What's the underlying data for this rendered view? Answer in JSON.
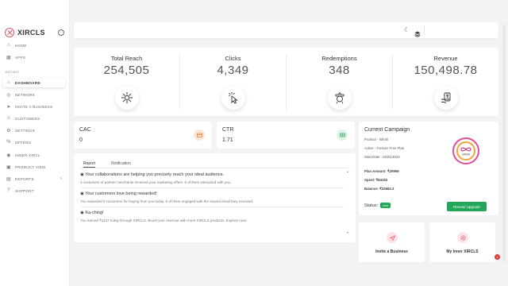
{
  "brand": {
    "name": "XIRCLS"
  },
  "sidebar": {
    "section_label": "INFINITI",
    "items": [
      {
        "label": "HOME"
      },
      {
        "label": "APPS"
      },
      {
        "label": "DASHBOARD"
      },
      {
        "label": "NETWORK"
      },
      {
        "label": "INVITE A BUSINESS"
      },
      {
        "label": "CUSTOMERS"
      },
      {
        "label": "SETTINGS"
      },
      {
        "label": "OFFERS"
      },
      {
        "label": "INNER XIRCL"
      },
      {
        "label": "PRODUCT VIEW"
      },
      {
        "label": "REPORTS"
      },
      {
        "label": "SUPPORT"
      }
    ]
  },
  "stats": [
    {
      "label": "Total Reach",
      "value": "254,505",
      "icon": "reach-icon"
    },
    {
      "label": "Clicks",
      "value": "4,349",
      "icon": "click-icon"
    },
    {
      "label": "Redemptions",
      "value": "348",
      "icon": "redemption-icon"
    },
    {
      "label": "Revenue",
      "value": "150,498.78",
      "icon": "revenue-icon"
    }
  ],
  "cac": {
    "label": "CAC",
    "value": "0"
  },
  "ctr": {
    "label": "CTR",
    "value": "1.71"
  },
  "report": {
    "tabs": [
      "Report",
      "Notification"
    ],
    "messages": [
      {
        "title": "Your collaborations are helping you precisely reach your ideal audience.",
        "body": "1 customers of partner merchants received your marketing offers. 0 of them interacted with you."
      },
      {
        "title": "Your customers love being rewarded!",
        "body": "You rewarded 0 customers for buying from you today. 0 of them engaged with the reward email they received."
      },
      {
        "title": "Ka-ching!",
        "body": "You earned ₹1147 today through XIRCLS. Boost your revenue with more XIRCLS products. Explore now!"
      }
    ]
  },
  "campaign": {
    "title": "Current Campaign",
    "product": "Product - Infiniti",
    "active": "Active - Forever Free Plan",
    "start_date": "Start Date - 02/01/2023",
    "plan_amount": "Plan Amount: ₹29999",
    "spent": "Spent: ₹84253",
    "balance": "Balance: ₹33584.3",
    "status_label": "Status:",
    "status_value": "Live",
    "renew_label": "Renew/ Upgrade",
    "logo_text": "Infiniti"
  },
  "actions": [
    {
      "label": "Invite a Business"
    },
    {
      "label": "My Inner XIRCLS"
    }
  ],
  "notification_count": "1",
  "colors": {
    "accent_green": "#21a757",
    "brand_red": "#d25b6a",
    "badge_orange": "#fde5d6",
    "badge_green": "#dff3e4"
  }
}
